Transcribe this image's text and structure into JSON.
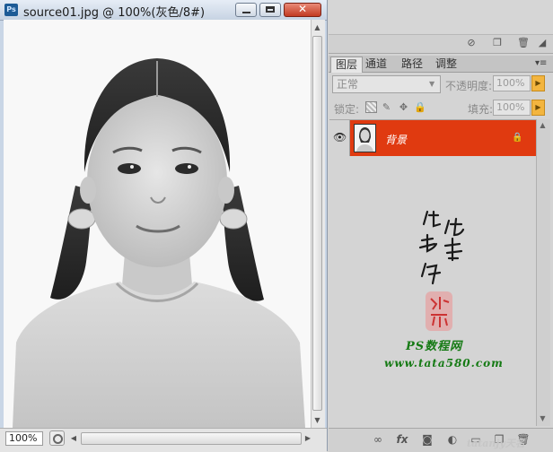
{
  "document_window": {
    "title": "source01.jpg @ 100%(灰色/8#)",
    "zoom": "100%"
  },
  "layers_panel": {
    "tabs": [
      {
        "label": "图层",
        "active": true
      },
      {
        "label": "通道",
        "active": false
      },
      {
        "label": "路径",
        "active": false
      },
      {
        "label": "调整",
        "active": false
      }
    ],
    "blend_mode": "正常",
    "opacity_label": "不透明度:",
    "opacity_value": "100%",
    "lock_label": "锁定:",
    "fill_label": "填充:",
    "fill_value": "100%",
    "layers": [
      {
        "name": "背景",
        "visible": true,
        "locked": true,
        "selected": true
      }
    ],
    "selected_color": "#e03a10"
  },
  "watermark": {
    "handwritten": "他她我帮你",
    "seal_text": "丝蓝",
    "ps_tutorial": "PS数程网",
    "url": "www.tata580.com",
    "corner": "tatanjy天名"
  },
  "icons": {
    "app": "photoshop-icon",
    "eye": "eye-icon",
    "lock": "lock-icon",
    "footer": [
      "link-layers-icon",
      "fx-icon",
      "add-mask-icon",
      "adjustment-layer-icon",
      "new-group-icon",
      "new-layer-icon",
      "trash-icon"
    ]
  }
}
